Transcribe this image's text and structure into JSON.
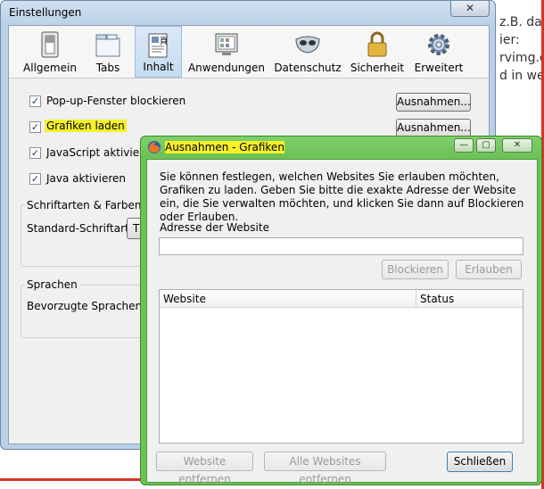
{
  "background": {
    "lines": [
      "z.B. da",
      "ier:",
      "rvimg.c",
      "d in we"
    ],
    "faint_text": "... Grafiken laden ..."
  },
  "prefs": {
    "title": "Einstellungen",
    "close_glyph": "✕",
    "tabs": [
      {
        "label": "Allgemein",
        "icon": "switch-icon"
      },
      {
        "label": "Tabs",
        "icon": "tabs-icon"
      },
      {
        "label": "Inhalt",
        "icon": "content-icon",
        "active": true
      },
      {
        "label": "Anwendungen",
        "icon": "applications-icon"
      },
      {
        "label": "Datenschutz",
        "icon": "mask-icon"
      },
      {
        "label": "Sicherheit",
        "icon": "lock-icon"
      },
      {
        "label": "Erweitert",
        "icon": "gear-icon"
      }
    ],
    "options": [
      {
        "label": "Pop-up-Fenster blockieren",
        "checked": true,
        "button": "Ausnahmen..."
      },
      {
        "label": "Grafiken laden",
        "checked": true,
        "button": "Ausnahmen...",
        "highlighted": true
      },
      {
        "label": "JavaScript aktivieren",
        "checked": true
      },
      {
        "label": "Java aktivieren",
        "checked": true
      }
    ],
    "fonts_group": {
      "title": "Schriftarten & Farben",
      "label": "Standard-Schriftart:",
      "value": "Ti"
    },
    "lang_group": {
      "title": "Sprachen",
      "label": "Bevorzugte Sprachen für"
    }
  },
  "exceptions": {
    "title": "Ausnahmen - Grafiken",
    "controls": {
      "minimize": "—",
      "maximize": "▢",
      "close": "✕"
    },
    "description": "Sie können festlegen, welchen Websites Sie erlauben möchten, Grafiken zu laden. Geben Sie bitte die exakte Adresse der Website ein, die Sie verwalten möchten, und klicken Sie dann auf Blockieren oder Erlauben.",
    "address_label": "Adresse der Website",
    "address_value": "",
    "block_button": "Blockieren",
    "allow_button": "Erlauben",
    "columns": [
      "Website",
      "Status"
    ],
    "rows": [],
    "remove_button": "Website entfernen",
    "remove_all_button": "Alle Websites entfernen",
    "close_button": "Schließen"
  },
  "colors": {
    "highlight": "#f6f02a",
    "ex_frame": "#6cc256",
    "prefs_frame": "#b9d0e6",
    "red_accent": "#d8322b"
  }
}
